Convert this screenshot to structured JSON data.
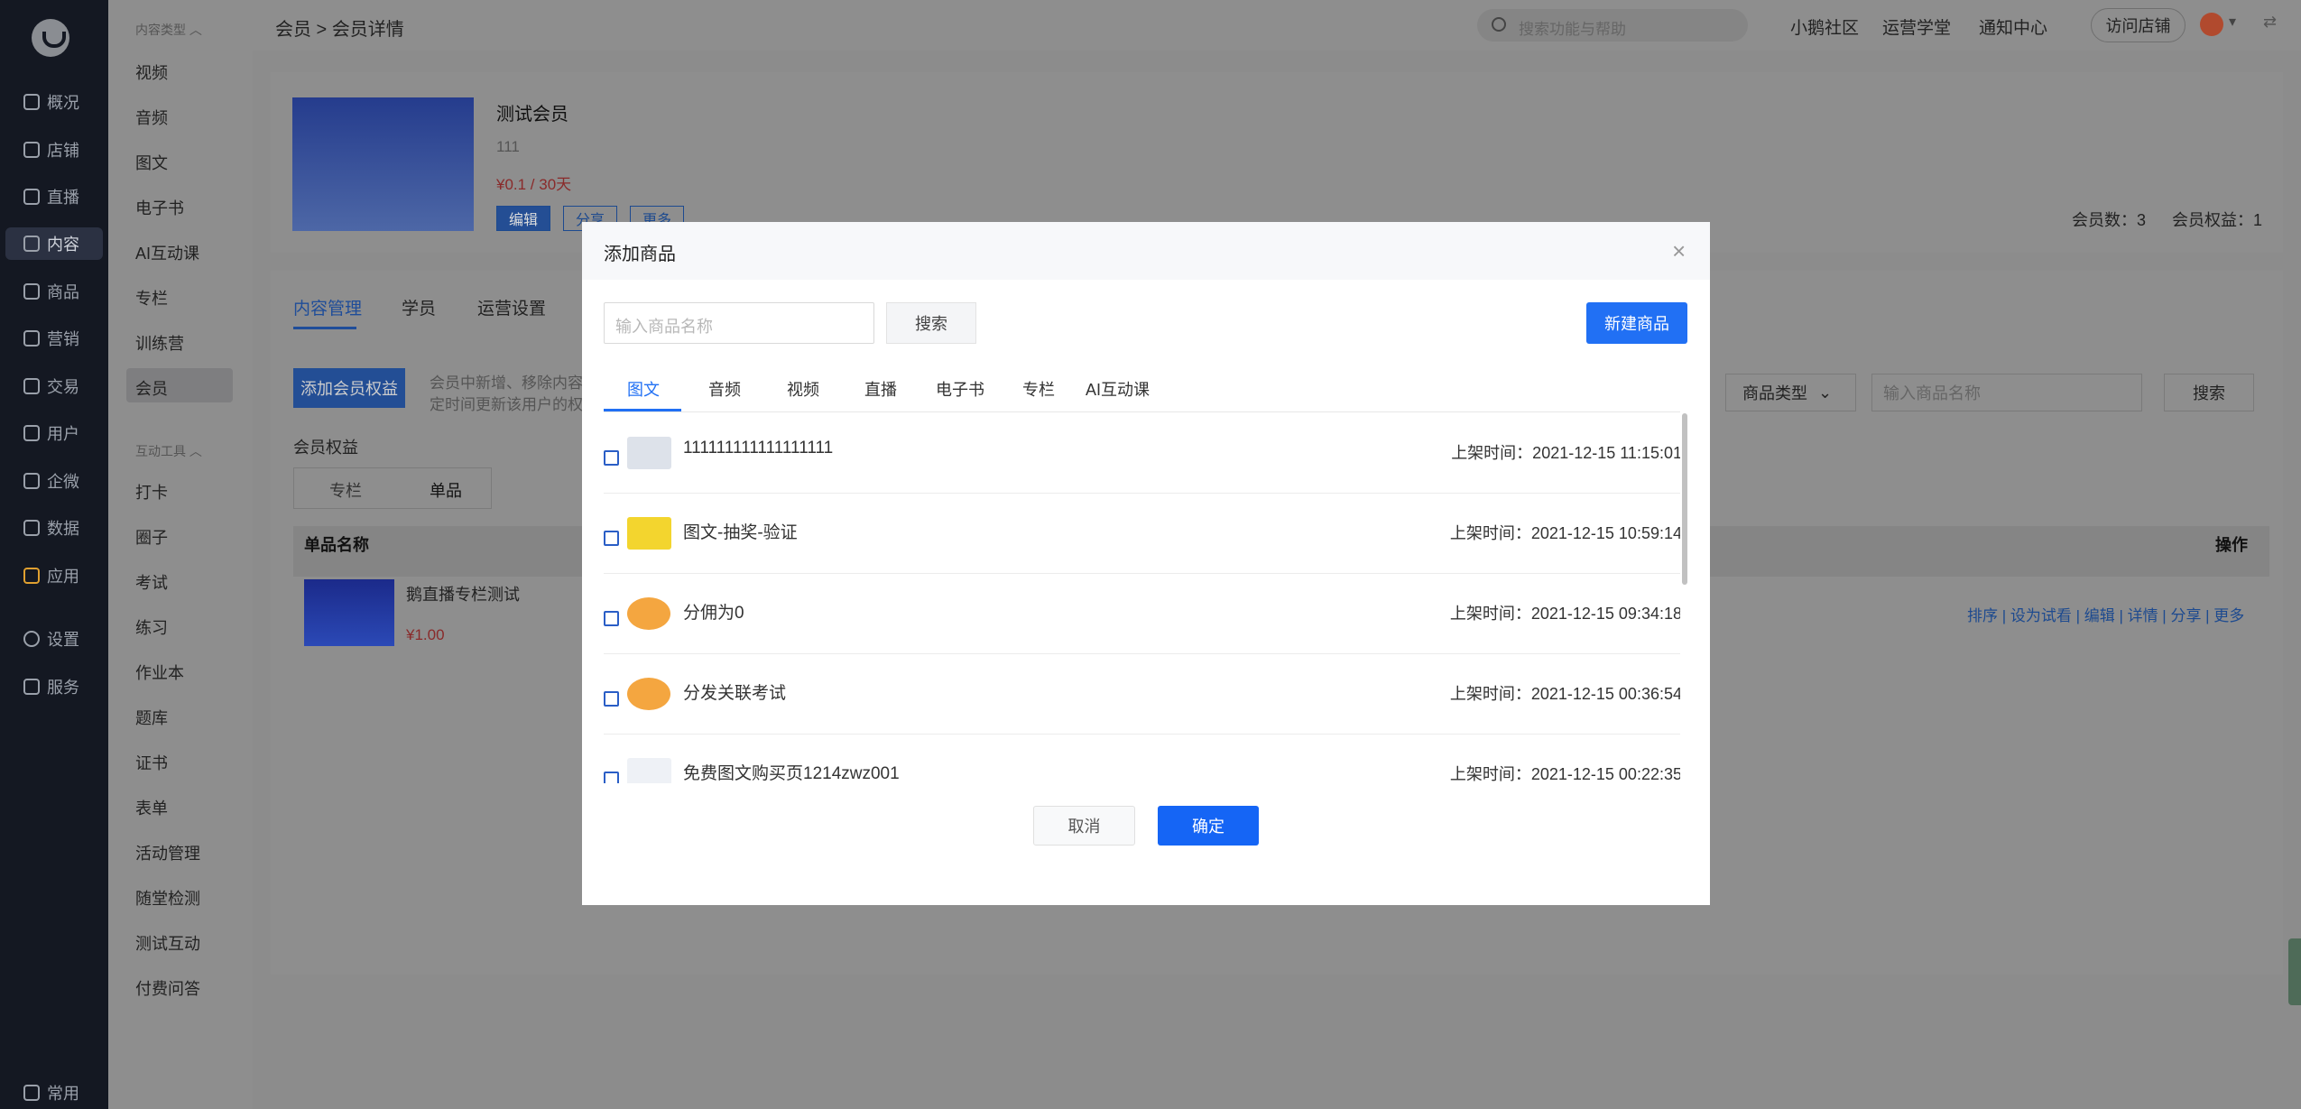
{
  "nav": {
    "items": [
      {
        "label": "概况",
        "icon": "pie-chart-icon"
      },
      {
        "label": "店铺",
        "icon": "store-icon"
      },
      {
        "label": "直播",
        "icon": "live-icon"
      },
      {
        "label": "内容",
        "icon": "content-icon"
      },
      {
        "label": "商品",
        "icon": "goods-icon"
      },
      {
        "label": "营销",
        "icon": "megaphone-icon"
      },
      {
        "label": "交易",
        "icon": "transaction-icon"
      },
      {
        "label": "用户",
        "icon": "user-icon"
      },
      {
        "label": "企微",
        "icon": "wecom-icon"
      },
      {
        "label": "数据",
        "icon": "data-icon"
      },
      {
        "label": "应用",
        "icon": "apps-icon"
      },
      {
        "label": "设置",
        "icon": "gear-icon"
      },
      {
        "label": "服务",
        "icon": "service-icon"
      }
    ],
    "bottom": "常用"
  },
  "submenu": {
    "group1": "内容类型",
    "group1_items": [
      "视频",
      "音频",
      "图文",
      "电子书",
      "AI互动课",
      "专栏",
      "训练营",
      "会员"
    ],
    "group2": "互动工具",
    "group2_items": [
      "打卡",
      "圈子",
      "考试",
      "练习",
      "作业本",
      "题库",
      "证书",
      "表单",
      "活动管理",
      "随堂检测",
      "测试互动",
      "付费问答"
    ]
  },
  "topbar": {
    "breadcrumb": "会员 > 会员详情",
    "search_placeholder": "搜索功能与帮助",
    "links": [
      "小鹅社区",
      "运营学堂",
      "通知中心"
    ],
    "visit": "访问店铺"
  },
  "member": {
    "name": "测试会员",
    "desc": "111",
    "price": "¥0.1 / 30天",
    "buttons": [
      "编辑",
      "分享",
      "更多"
    ],
    "member_count": "会员数：3",
    "rights_count": "会员权益：1"
  },
  "content": {
    "tabs": [
      "内容管理",
      "学员",
      "运营设置"
    ],
    "add_rights": "添加会员权益",
    "tip_line1": "会员中新增、移除内容",
    "tip_line2": "定时间更新该用户的权",
    "rights_label": "会员权益",
    "subtabs": [
      "专栏",
      "单品"
    ],
    "table_header": "单品名称",
    "ops_header": "操作",
    "item_name": "鹅直播专栏测试",
    "item_price": "¥1.00",
    "ops": "排序 | 设为试看 | 编辑 | 详情 | 分享 | 更多",
    "type_select": "商品类型",
    "name_placeholder": "输入商品名称",
    "search": "搜索"
  },
  "modal": {
    "title": "添加商品",
    "name_placeholder": "输入商品名称",
    "search": "搜索",
    "new_goods": "新建商品",
    "tabs": [
      "图文",
      "音频",
      "视频",
      "直播",
      "电子书",
      "专栏",
      "AI互动课"
    ],
    "rows": [
      {
        "name": "111111111111111111",
        "time": "上架时间：2021-12-15 11:15:01"
      },
      {
        "name": "图文-抽奖-验证",
        "time": "上架时间：2021-12-15 10:59:14"
      },
      {
        "name": "分佣为0",
        "time": "上架时间：2021-12-15 09:34:18"
      },
      {
        "name": "分发关联考试",
        "time": "上架时间：2021-12-15 00:36:54"
      },
      {
        "name": "免费图文购买页1214zwz001",
        "time": "上架时间：2021-12-15 00:22:35"
      }
    ],
    "cancel": "取消",
    "confirm": "确定"
  },
  "colors": {
    "accent": "#2170f4",
    "price": "#e02020"
  }
}
